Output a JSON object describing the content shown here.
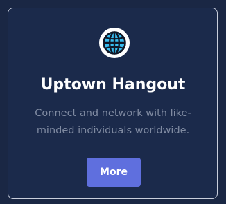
{
  "card": {
    "icon": "globe-icon",
    "title": "Uptown Hangout",
    "description": "Connect and network with like-minded individuals worldwide.",
    "button_label": "More"
  },
  "colors": {
    "background": "#1a2744",
    "card_border": "#c9cedb",
    "title": "#ffffff",
    "description": "#7f8aa1",
    "button": "#5f6fde",
    "icon_fill": "#38bdf0"
  }
}
